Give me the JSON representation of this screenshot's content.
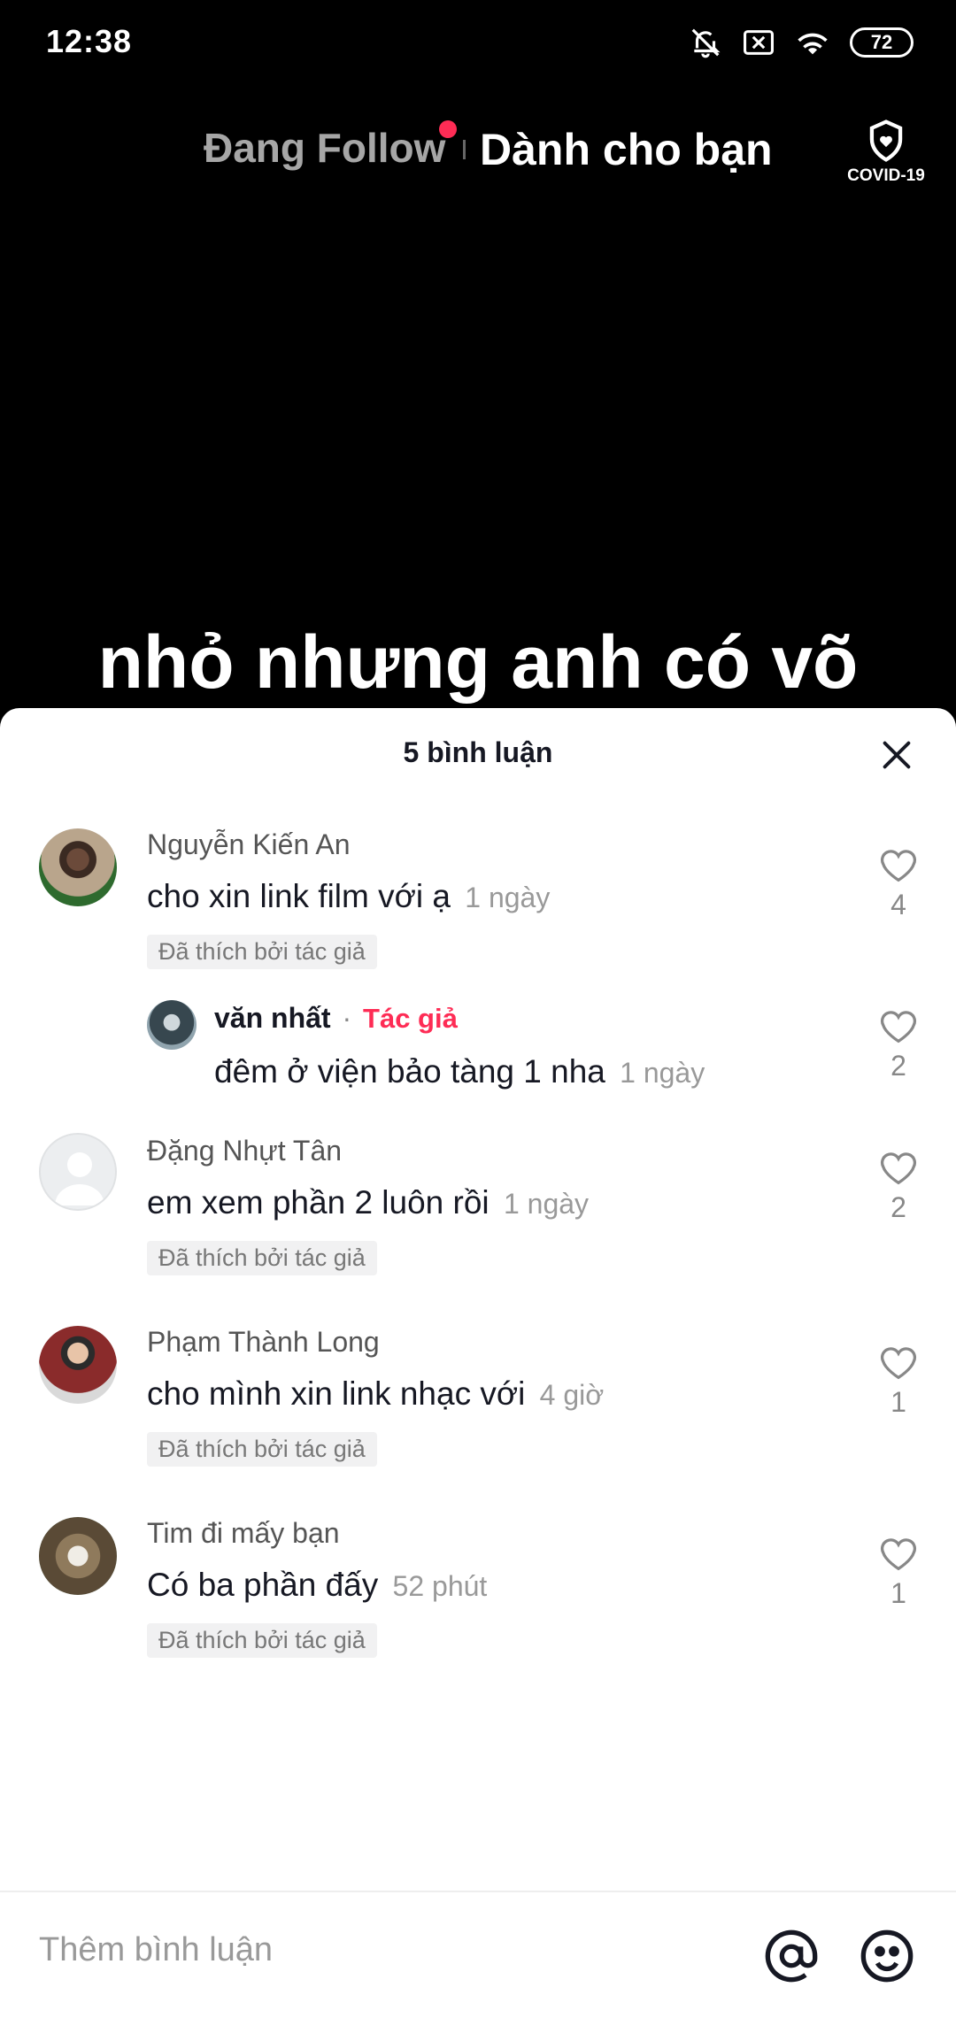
{
  "status": {
    "time": "12:38",
    "battery": "72"
  },
  "nav": {
    "following": "Đang Follow",
    "for_you": "Dành cho bạn",
    "covid": "COVID-19"
  },
  "video": {
    "caption": "nhỏ nhưng anh có võ"
  },
  "comments_sheet": {
    "title": "5 bình luận",
    "comments": [
      {
        "name": "Nguyễn Kiến An",
        "text": "cho xin link film với ạ",
        "time": "1 ngày",
        "badge": "Đã thích bởi tác giả",
        "likes": "4"
      },
      {
        "name": "văn nhất",
        "author_tag": "Tác giả",
        "separator": "·",
        "text": "đêm ở viện bảo tàng 1 nha",
        "time": "1 ngày",
        "likes": "2"
      },
      {
        "name": "Đặng Nhựt Tân",
        "text": "em xem phần 2 luôn rồi",
        "time": "1 ngày",
        "badge": "Đã thích bởi tác giả",
        "likes": "2"
      },
      {
        "name": "Phạm Thành Long",
        "text": "cho mình xin link nhạc với",
        "time": "4 giờ",
        "badge": "Đã thích bởi tác giả",
        "likes": "1"
      },
      {
        "name": "Tim đi mấy bạn",
        "text": "Có ba phần đấy",
        "time": "52 phút",
        "badge": "Đã thích bởi tác giả",
        "likes": "1"
      }
    ]
  },
  "input": {
    "placeholder": "Thêm bình luận"
  },
  "colors": {
    "accent": "#fe2c55",
    "text": "#161823",
    "muted": "#999999"
  }
}
